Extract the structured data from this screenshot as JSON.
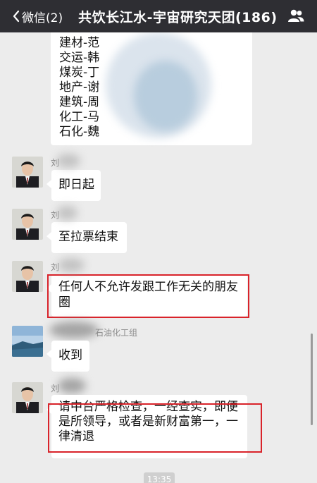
{
  "navbar": {
    "back_label": "微信(2)",
    "title": "共饮长江水-宇宙研究天团(186)",
    "bg_color": "#2e2e33"
  },
  "top_list": {
    "lines": [
      "建材-范",
      "交运-韩",
      "煤炭-丁",
      "地产-谢",
      "建筑-周",
      "化工-马",
      "石化-魏"
    ]
  },
  "messages": [
    {
      "sender": "刘",
      "text": "即日起"
    },
    {
      "sender": "刘",
      "text": "至拉票结束"
    },
    {
      "sender": "刘",
      "text_line1": "任何人不允许发跟工作无关的朋友",
      "text_line2": "圈"
    },
    {
      "sender": "石油化工组",
      "text": "收到"
    },
    {
      "sender": "刘",
      "text_line1": "请中台严格检查，一经查实，即便",
      "text_line2": "是所领导，或者是新财富第一，一",
      "text_line3": "律清退"
    }
  ],
  "timestamp": "13:35",
  "highlight_color": "#d9232a"
}
